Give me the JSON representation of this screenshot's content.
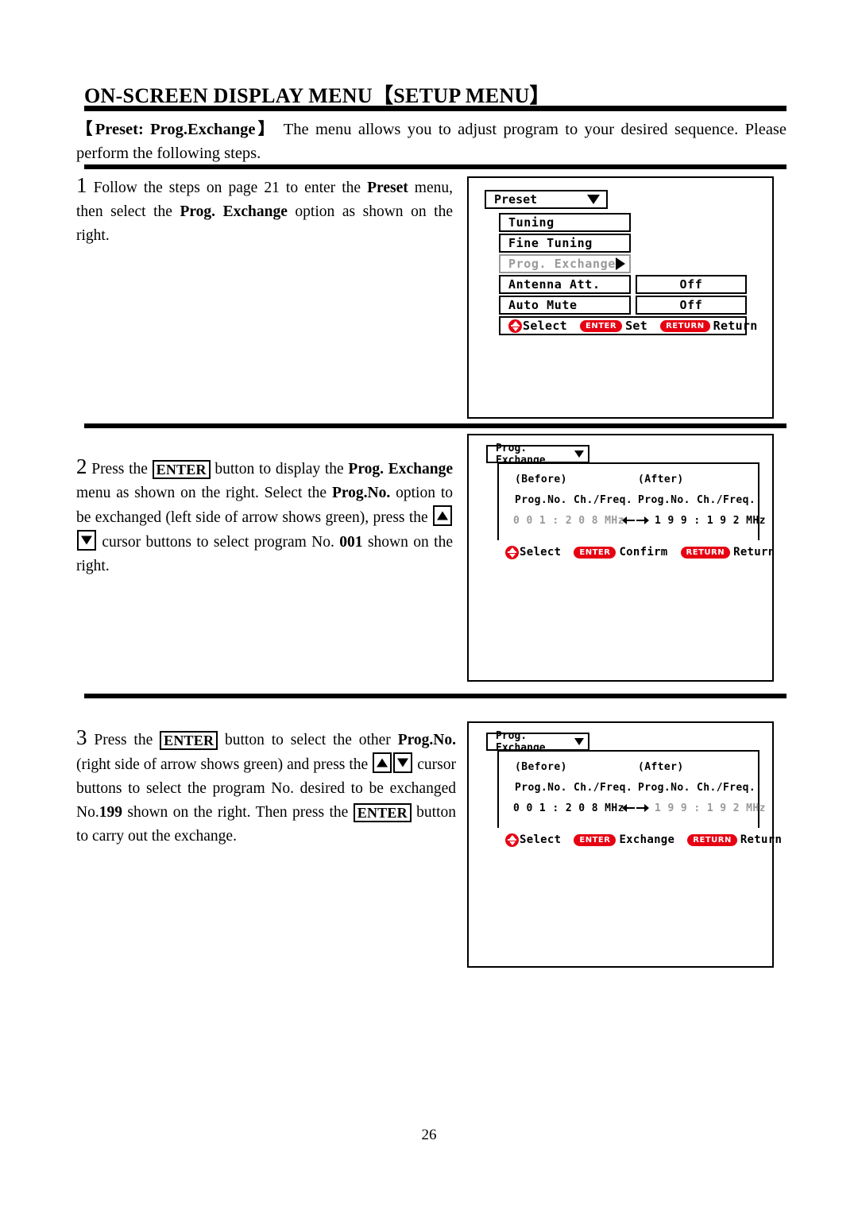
{
  "document": {
    "title": "ON-SCREEN DISPLAY MENU【SETUP MENU】",
    "intro_bold": "【Preset: Prog.Exchange】",
    "intro_text": " The menu allows you to adjust program to your desired sequence. Please perform the following steps.",
    "page_number": "26"
  },
  "steps": [
    {
      "number": "1",
      "parts": {
        "t1": " Follow the steps on page 21 to enter the ",
        "b1": "Preset",
        "t2": " menu, then select the ",
        "b2": "Prog. Exchange",
        "t3": " option as shown on the right."
      }
    },
    {
      "number": "2",
      "parts": {
        "t1": " Press the ",
        "k1": "ENTER",
        "t2": " button to display the ",
        "b1": "Prog. Exchange",
        "t3": " menu as shown on the right. Select the ",
        "b2": "Prog.No.",
        "t4": " option to be exchanged (left side of arrow shows green), press the ",
        "k2": "▲",
        "k3": "▼",
        "t5": " cursor buttons to select program No. ",
        "b3": "001",
        "t6": " shown on the right."
      }
    },
    {
      "number": "3",
      "parts": {
        "t1": " Press the ",
        "k1": "ENTER",
        "t2": " button to select the other ",
        "b1": "Prog.No.",
        "t3": " (right side of arrow shows green) and press the ",
        "k2": "▲",
        "k3": "▼",
        "t4": " cursor buttons to select the program No. desired to be exchanged No.",
        "b2": "199",
        "t5": " shown on the right. Then press the ",
        "k4": "ENTER",
        "t6": " button to carry out the exchange."
      }
    }
  ],
  "osd_preset": {
    "title": "Preset",
    "title_icon": "chevron-down-icon",
    "rows": [
      {
        "label": "Tuning",
        "value": "",
        "dim": false,
        "arrow": false
      },
      {
        "label": "Fine Tuning",
        "value": "",
        "dim": false,
        "arrow": false
      },
      {
        "label": "Prog. Exchange",
        "value": "",
        "dim": true,
        "arrow": true
      },
      {
        "label": "Antenna Att.",
        "value": "Off",
        "dim": false,
        "arrow": false
      },
      {
        "label": "Auto Mute",
        "value": "Off",
        "dim": false,
        "arrow": false
      }
    ],
    "hint": {
      "select_label": "Select",
      "enter_pill": "ENTER",
      "enter_label": "Set",
      "return_pill": "RETURN",
      "return_label": "Return"
    }
  },
  "osd_exchange_step2": {
    "title": "Prog. Exchange",
    "title_icon": "chevron-down-icon",
    "col_before": "(Before)",
    "col_after": "(After)",
    "head_before": "Prog.No.  Ch./Freq.",
    "head_after": "Prog.No.  Ch./Freq.",
    "value_before": "0 0 1 : 2 0 8 MHz",
    "value_after": "1 9 9 : 1 9 2 MHz",
    "before_dim": true,
    "after_dim": false,
    "arrow_icon": "left-right-arrow-icon",
    "hint": {
      "select_label": "Select",
      "enter_pill": "ENTER",
      "enter_label": "Confirm",
      "return_pill": "RETURN",
      "return_label": "Return"
    }
  },
  "osd_exchange_step3": {
    "title": "Prog. Exchange",
    "title_icon": "chevron-down-icon",
    "col_before": "(Before)",
    "col_after": "(After)",
    "head_before": "Prog.No.  Ch./Freq.",
    "head_after": "Prog.No.  Ch./Freq.",
    "value_before": "0 0 1 : 2 0 8 MHz",
    "value_after": "1 9 9 : 1 9 2 MHz",
    "before_dim": false,
    "after_dim": true,
    "arrow_icon": "left-right-arrow-icon",
    "hint": {
      "select_label": "Select",
      "enter_pill": "ENTER",
      "enter_label": "Exchange",
      "return_pill": "RETURN",
      "return_label": "Return"
    }
  },
  "colors": {
    "accent_red": "#e60012",
    "dim_gray": "#9a9a9a",
    "ink": "#000000"
  }
}
